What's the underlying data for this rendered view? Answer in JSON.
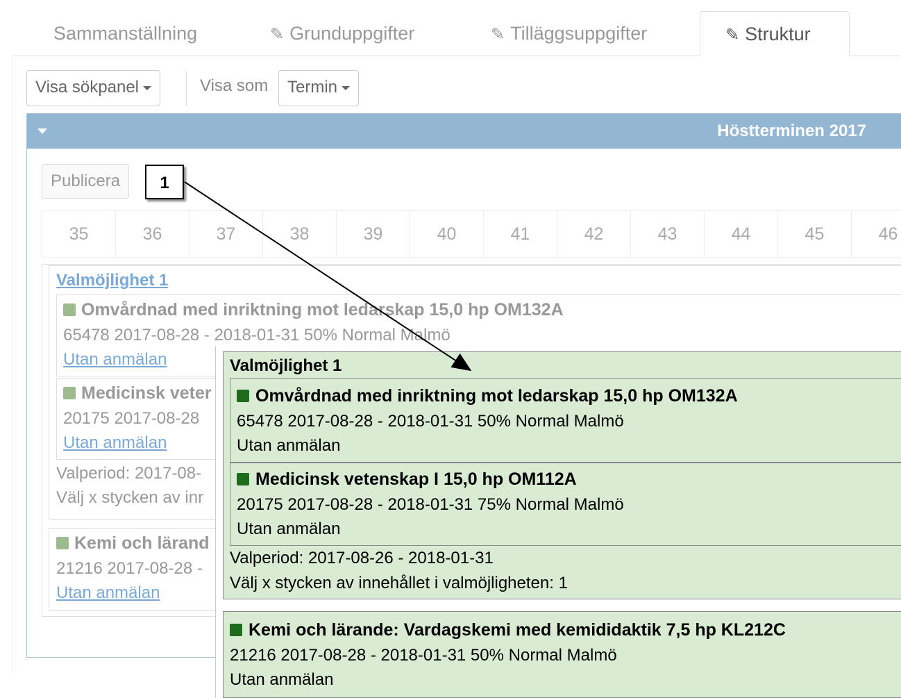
{
  "tabs": [
    {
      "label": "Sammanställning",
      "icon": "none"
    },
    {
      "label": "Grunduppgifter",
      "icon": "pencil-icon"
    },
    {
      "label": "Tilläggsuppgifter",
      "icon": "pencil-icon"
    },
    {
      "label": "Struktur",
      "icon": "pencil-icon",
      "active": true
    }
  ],
  "toolbar": {
    "search_panel_label": "Visa sökpanel",
    "view_as_label": "Visa som",
    "view_as_value": "Termin"
  },
  "term_panel": {
    "title": "Höstterminen 2017",
    "publish_label": "Publicera",
    "callout_number": "1",
    "weeks": [
      "35",
      "36",
      "37",
      "38",
      "39",
      "40",
      "41",
      "42",
      "43",
      "44",
      "45",
      "46"
    ]
  },
  "background": {
    "option_title": "Valmöjlighet 1",
    "course1_title": "Omvårdnad med inriktning mot ledarskap 15,0 hp OM132A",
    "course1_details": "65478 2017-08-28 - 2018-01-31 50% Normal Malmö",
    "course1_link": "Utan anmälan",
    "course2_title": "Medicinsk veter",
    "course2_details": "20175 2017-08-28",
    "course2_link": "Utan anmälan",
    "period": "Valperiod: 2017-08-",
    "choose": "Välj x stycken av inr",
    "course3_title": "Kemi och lärand",
    "course3_details": "21216 2017-08-28 -",
    "course3_link": "Utan anmälan"
  },
  "popup": {
    "option_title": "Valmöjlighet 1",
    "course1_title": "Omvårdnad med inriktning mot ledarskap 15,0 hp OM132A",
    "course1_details": "65478 2017-08-28 - 2018-01-31 50% Normal Malmö",
    "course1_registration": "Utan anmälan",
    "course2_title": "Medicinsk vetenskap I 15,0 hp OM112A",
    "course2_details": "20175 2017-08-28 - 2018-01-31 75% Normal Malmö",
    "course2_registration": "Utan anmälan",
    "period": "Valperiod: 2017-08-26 - 2018-01-31",
    "choose": "Välj x stycken av innehållet i valmöjligheten: 1",
    "course3_title": "Kemi och lärande: Vardagskemi med kemididaktik 7,5 hp KL212C",
    "course3_details": "21216 2017-08-28 - 2018-01-31 50% Normal Malmö",
    "course3_registration": "Utan anmälan"
  },
  "colors": {
    "panel_header": "#93b6d2",
    "popup_bg": "#d9ebd2",
    "course_square": "#1e6b1e",
    "link": "#79a9d6"
  }
}
